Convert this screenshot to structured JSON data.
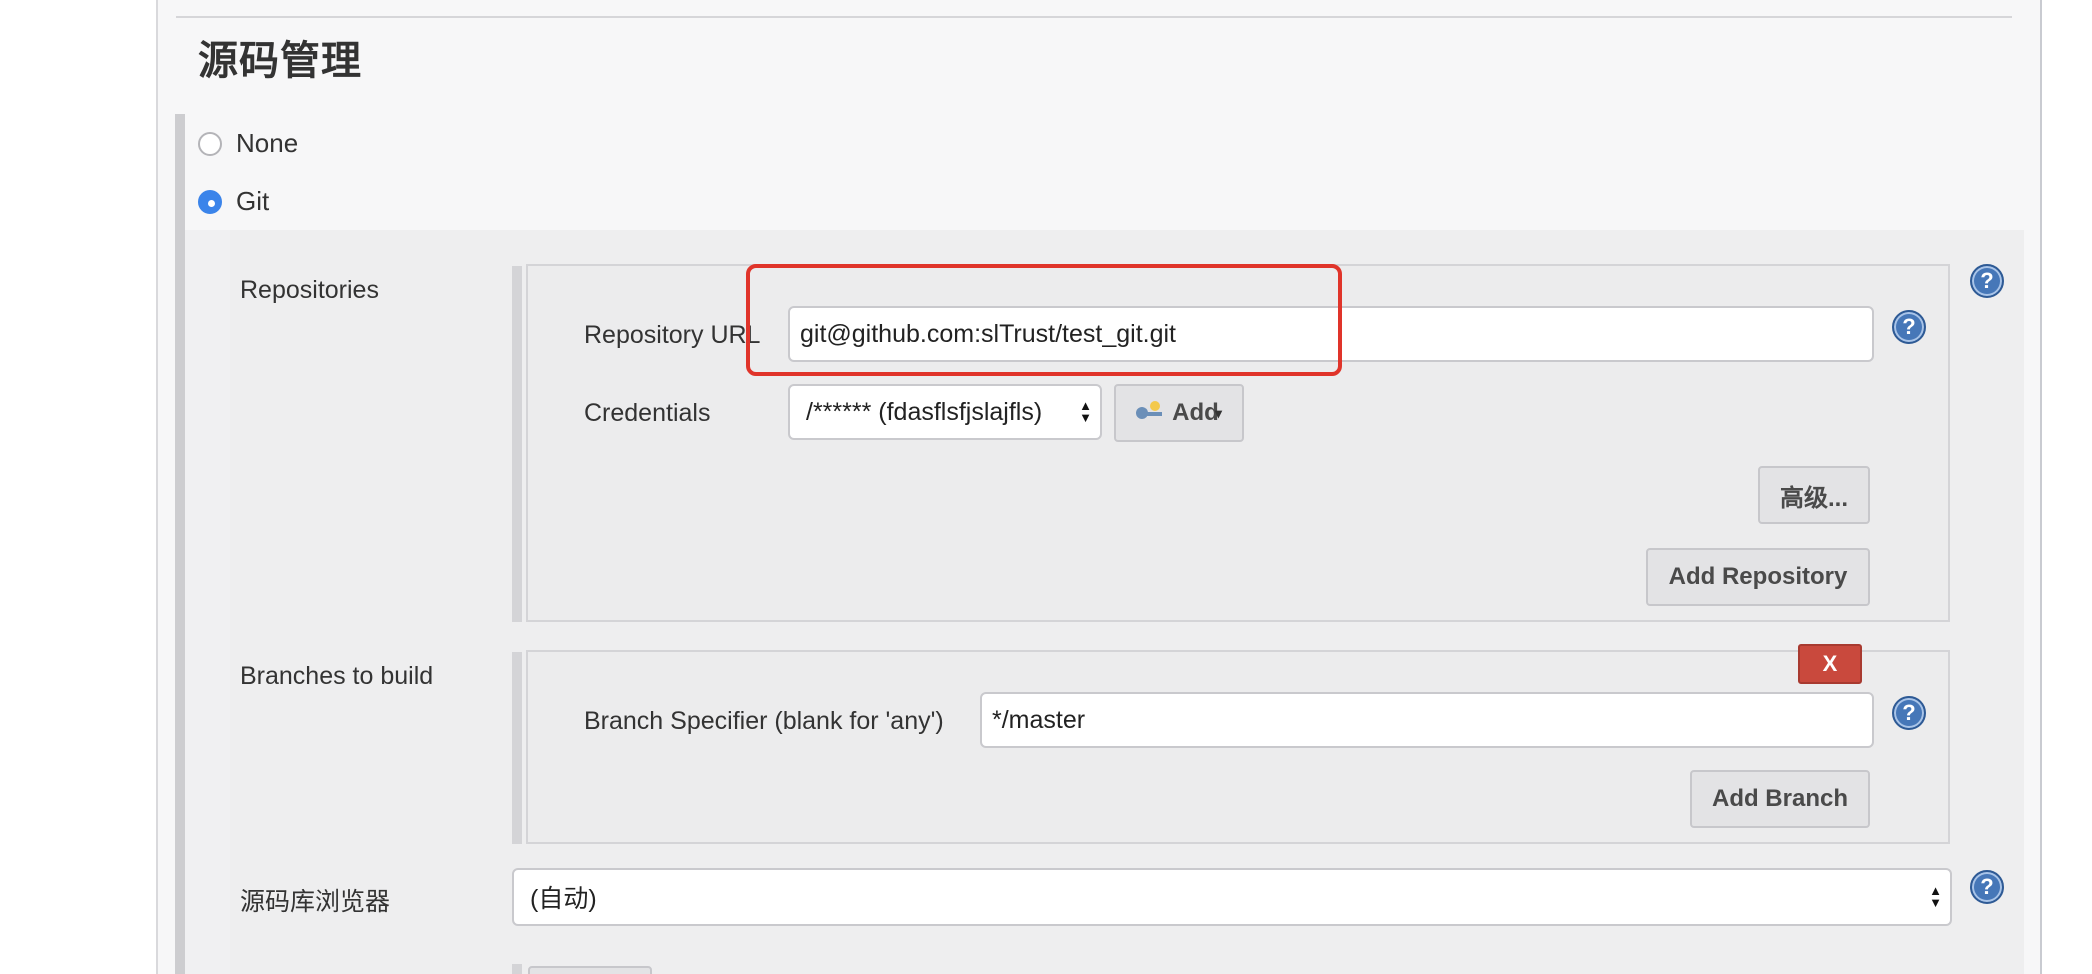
{
  "section": {
    "title": "源码管理"
  },
  "scm_options": {
    "none_label": "None",
    "git_label": "Git",
    "selected": "Git"
  },
  "repositories": {
    "label": "Repositories",
    "url_label": "Repository URL",
    "url_value": "git@github.com:slTrust/test_git.git",
    "credentials_label": "Credentials",
    "credentials_value": "/****** (fdasflsfjslajfls)",
    "add_credentials_label": "Add",
    "advanced_button": "高级...",
    "add_repository_button": "Add Repository"
  },
  "branches": {
    "label": "Branches to build",
    "delete_button": "X",
    "specifier_label": "Branch Specifier (blank for 'any')",
    "specifier_value": "*/master",
    "add_branch_button": "Add Branch"
  },
  "browser": {
    "label": "源码库浏览器",
    "value": "(自动)"
  },
  "help": {
    "glyph": "?"
  },
  "colors": {
    "highlight": "#e0342a",
    "radio_accent": "#3b84ea",
    "delete_red": "#c9493d",
    "help_blue": "#4677b8"
  }
}
